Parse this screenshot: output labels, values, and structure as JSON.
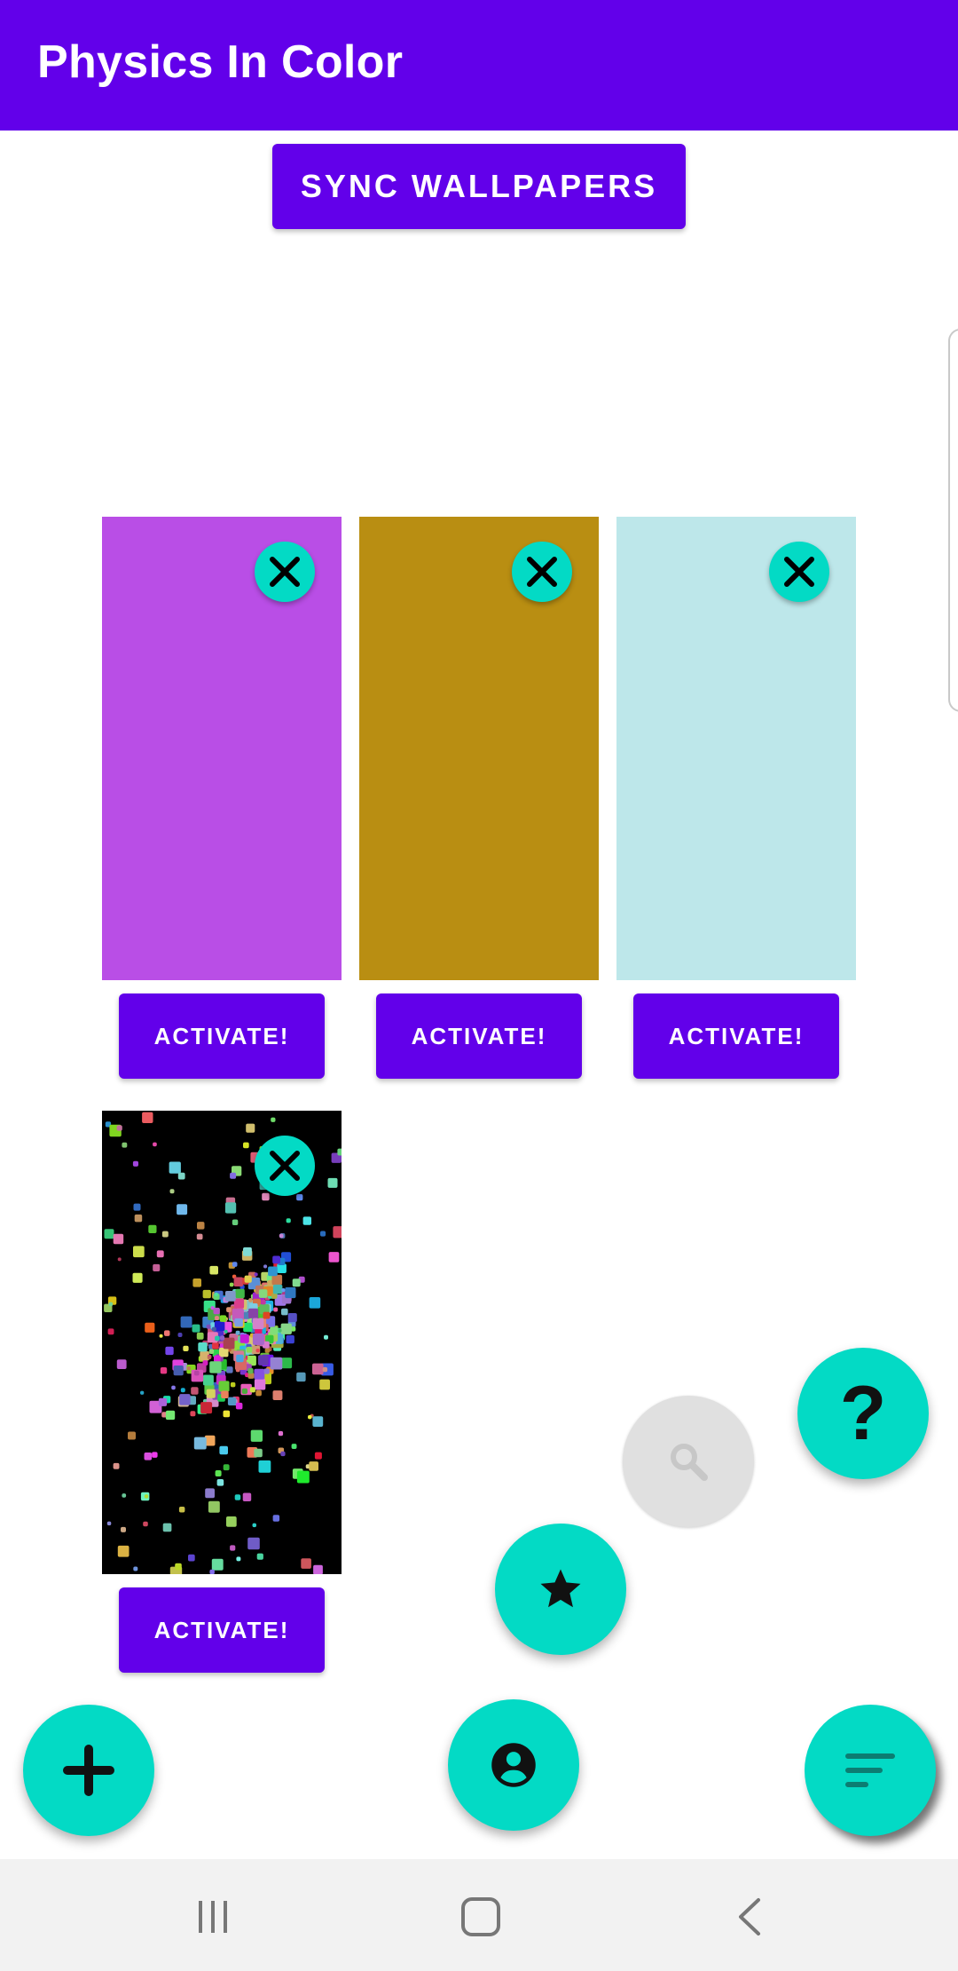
{
  "app": {
    "title": "Physics In Color"
  },
  "actions": {
    "sync_label": "SYNC WALLPAPERS"
  },
  "wallpapers": [
    {
      "color": "#b94ee6",
      "activate_label": "ACTIVATE!"
    },
    {
      "color": "#b98e12",
      "activate_label": "ACTIVATE!"
    },
    {
      "color": "#bde7ea",
      "activate_label": "ACTIVATE!"
    },
    {
      "color": "#000000",
      "activate_label": "ACTIVATE!"
    }
  ],
  "fabs": {
    "help_label": "?",
    "icons": [
      "question-icon",
      "search-icon",
      "star-icon",
      "plus-icon",
      "account-circle-icon",
      "sort-icon"
    ]
  },
  "colors": {
    "primary": "#6200ea",
    "accent": "#03dac5",
    "disabled": "#e0e0e0"
  },
  "navbar": {
    "icons": [
      "recent-apps-icon",
      "home-icon",
      "back-icon"
    ]
  }
}
